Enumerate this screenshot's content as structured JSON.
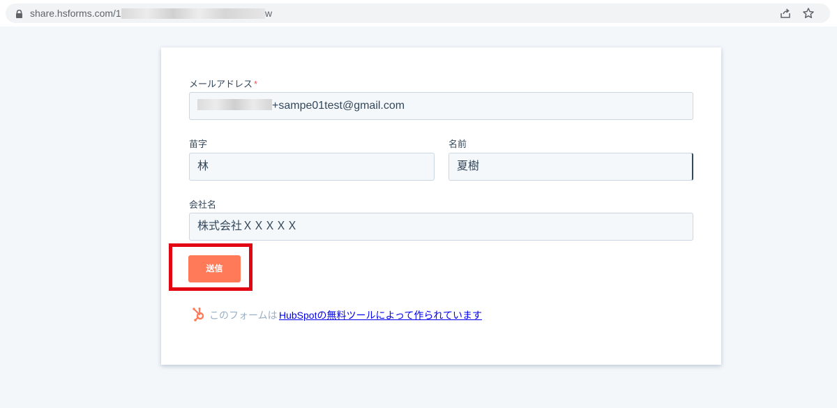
{
  "browser": {
    "url_start": "share.hsforms.com/1N",
    "url_end": "w"
  },
  "form": {
    "email": {
      "label": "メールアドレス",
      "required_mark": "*",
      "value": "+sampe01test@gmail.com"
    },
    "last_name": {
      "label": "苗字",
      "value": "林"
    },
    "first_name": {
      "label": "名前",
      "value": "夏樹"
    },
    "company": {
      "label": "会社名",
      "value": "株式会社ＸＸＸＸＸ"
    },
    "submit_label": "送信",
    "highlight_color": "#e10612",
    "button_color": "#ff7a59"
  },
  "footer": {
    "text": "このフォームは",
    "link_text": "HubSpotの無料ツールによって作られています",
    "icon": "hubspot-sprocket-icon"
  }
}
